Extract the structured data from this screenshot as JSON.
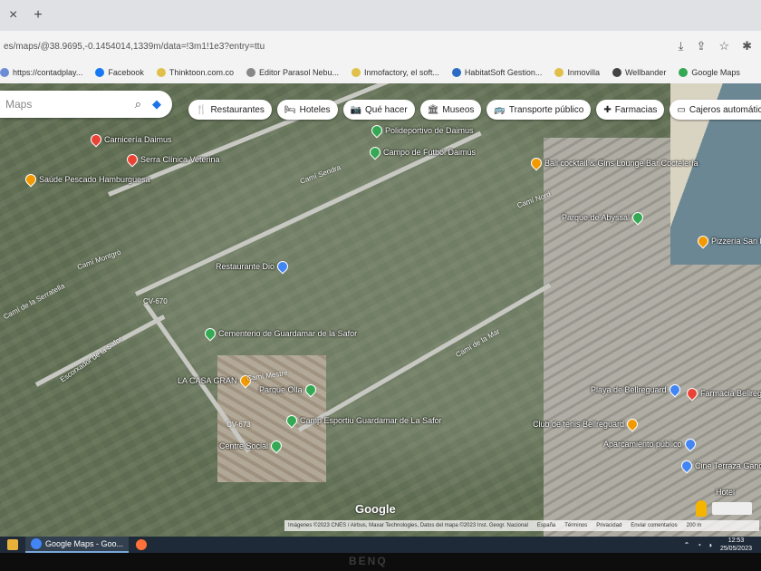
{
  "browser": {
    "tab_close": "×",
    "new_tab": "+",
    "url": "es/maps/@38.9695,-0.1454014,1339m/data=!3m1!1e3?entry=ttu",
    "omni_icons": [
      "download-icon",
      "share-icon",
      "bookmark-star-icon",
      "extensions-icon"
    ],
    "bookmarks": [
      {
        "label": "https://contadplay...",
        "icon": "bookmark-site-icon",
        "color": "#6d8cd6"
      },
      {
        "label": "Facebook",
        "icon": "facebook-icon",
        "color": "#1877f2"
      },
      {
        "label": "Thinktoon.com.co",
        "icon": "bookmark-site-icon",
        "color": "#e0c04a"
      },
      {
        "label": "Editor Parasol Nebu...",
        "icon": "bookmark-site-icon",
        "color": "#888888"
      },
      {
        "label": "Inmofactory, el soft...",
        "icon": "bookmark-site-icon",
        "color": "#e0c04a"
      },
      {
        "label": "HabitatSoft Gestion...",
        "icon": "bookmark-site-icon",
        "color": "#2b6cc4"
      },
      {
        "label": "Inmovilla",
        "icon": "bookmark-site-icon",
        "color": "#e0c04a"
      },
      {
        "label": "Wellbander",
        "icon": "bookmark-site-icon",
        "color": "#444444"
      },
      {
        "label": "Google Maps",
        "icon": "google-maps-icon",
        "color": "#34a853"
      }
    ]
  },
  "maps": {
    "search_placeholder": "Maps",
    "categories": [
      {
        "label": "Restaurantes",
        "icon": "restaurant-icon"
      },
      {
        "label": "Hoteles",
        "icon": "hotel-icon"
      },
      {
        "label": "Qué hacer",
        "icon": "camera-icon"
      },
      {
        "label": "Museos",
        "icon": "museum-icon"
      },
      {
        "label": "Transporte público",
        "icon": "transit-icon"
      },
      {
        "label": "Farmacias",
        "icon": "pharmacy-icon"
      },
      {
        "label": "Cajeros automáticos",
        "icon": "atm-icon"
      }
    ],
    "pois": [
      {
        "label": "Polideportivo de Daimus",
        "color": "#34a853"
      },
      {
        "label": "Campo de Fútbol Daimús",
        "color": "#34a853"
      },
      {
        "label": "Bali cocktail & Gins Lounge Bar Coctelería",
        "color": "#f29900"
      },
      {
        "label": "Serra Clínica Veterina",
        "color": "#ea4335"
      },
      {
        "label": "Saúde Pescado Hamburguesa",
        "color": "#f29900"
      },
      {
        "label": "Carnicería Daimus",
        "color": "#ea4335"
      },
      {
        "label": "Restaurante Dio",
        "color": "#4285f4"
      },
      {
        "label": "Cementerio de Guardamar de la Safor",
        "color": "#34a853"
      },
      {
        "label": "LA CASA GRAN",
        "color": "#f29900"
      },
      {
        "label": "Parque Olla",
        "color": "#34a853"
      },
      {
        "label": "Camp Esportiu Guardamar de La Safor",
        "color": "#34a853"
      },
      {
        "label": "Centre Social",
        "color": "#34a853"
      },
      {
        "label": "Parque de Abyssal",
        "color": "#34a853"
      },
      {
        "label": "Playa de Bellreguard",
        "color": "#4285f4"
      },
      {
        "label": "Club de tenis Bellreguard",
        "color": "#f29900"
      },
      {
        "label": "Aparcamiento público",
        "color": "#4285f4"
      },
      {
        "label": "Farmacia Bellreguard",
        "color": "#ea4335"
      },
      {
        "label": "Cine Terraza Gandia",
        "color": "#4285f4"
      },
      {
        "label": "Hotel",
        "color": "#4285f4"
      },
      {
        "label": "Pizzería San M",
        "color": "#f29900"
      }
    ],
    "streets": [
      "Camí Montgrò",
      "Camí de la Serratella",
      "Escorxador de la Safor",
      "Camí Mestre",
      "Camí de la Mar",
      "Camí Sendra",
      "Camí Nord",
      "CV-670",
      "CV-673"
    ],
    "google_logo": "Google",
    "attribution": "Imágenes ©2023 CNES / Airbus, Maxar Technologies, Datos del mapa ©2023 Inst. Geogr. Nacional",
    "footer_links": [
      "España",
      "Términos",
      "Privacidad",
      "Enviar comentarios",
      "200 m"
    ]
  },
  "taskbar": {
    "items": [
      {
        "label": "",
        "icon": "file-explorer-icon",
        "color": "#e8b23a"
      },
      {
        "label": "Google Maps - Goo...",
        "icon": "chrome-icon",
        "color": "#4285f4",
        "active": true
      },
      {
        "label": "",
        "icon": "firefox-icon",
        "color": "#ff7139"
      }
    ],
    "time": "12:53",
    "date": "25/05/2023"
  },
  "monitor_brand": "BENQ"
}
